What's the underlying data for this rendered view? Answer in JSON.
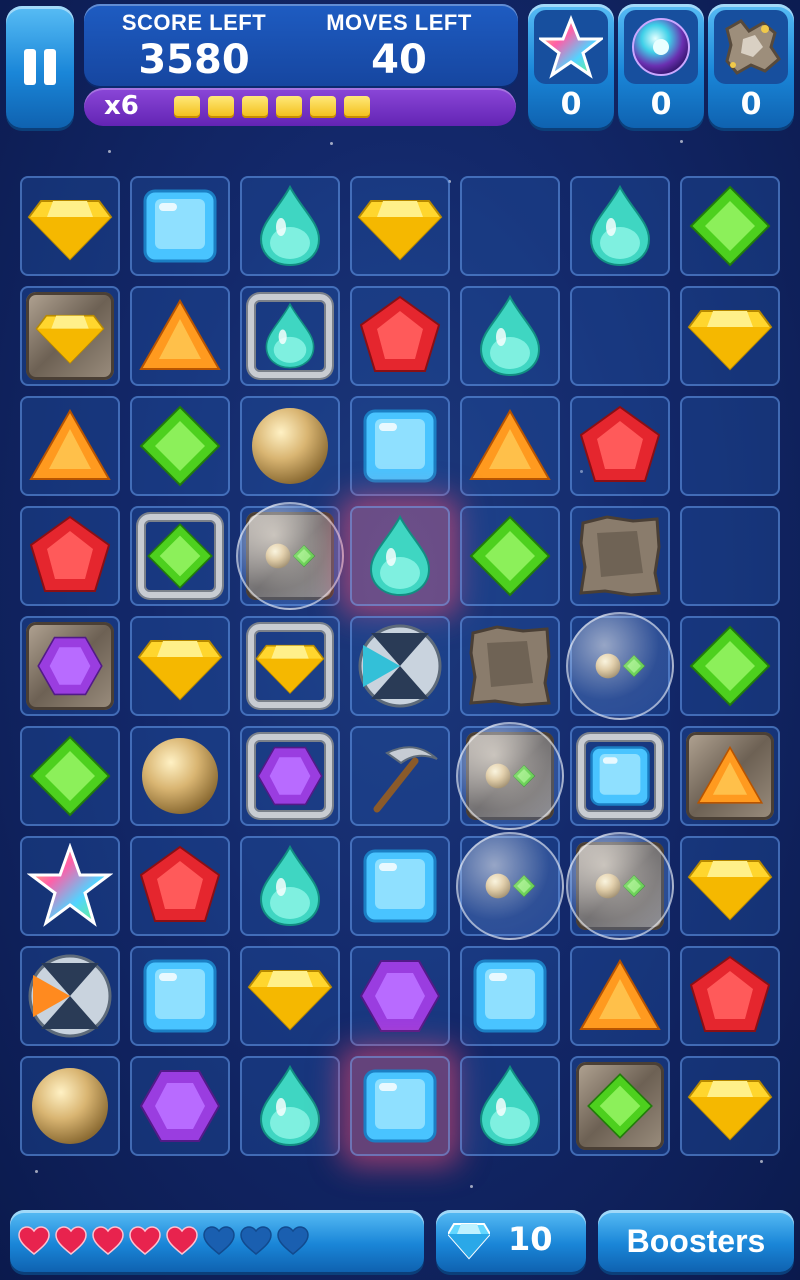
{
  "hud": {
    "score_label": "SCORE LEFT",
    "score_value": "3580",
    "moves_label": "MOVES LEFT",
    "moves_value": "40",
    "multiplier": "x6",
    "multiplier_segments_filled": 6,
    "boosters": [
      {
        "icon": "rainbow-star-icon",
        "count": "0"
      },
      {
        "icon": "color-bomb-orb-icon",
        "count": "0"
      },
      {
        "icon": "rock-blast-icon",
        "count": "0"
      }
    ]
  },
  "board": {
    "columns": 7,
    "rows": 9,
    "cells": [
      [
        "yellow-diamond",
        "blue-square",
        "teal-drop",
        "yellow-diamond",
        "empty",
        "teal-drop",
        "green-rhombus"
      ],
      [
        "rock-yellow-diamond",
        "orange-triangle",
        "chained-teal-drop",
        "red-pentagon",
        "teal-drop",
        "empty",
        "yellow-diamond"
      ],
      [
        "orange-triangle",
        "green-rhombus",
        "tan-ball",
        "blue-square",
        "orange-triangle",
        "red-pentagon",
        "empty"
      ],
      [
        "red-pentagon",
        "chained-green-cross",
        "rock-bubble-mix",
        "glow-teal-drop",
        "green-rhombus",
        "rock-block",
        "empty"
      ],
      [
        "rock-purple-hexagon",
        "yellow-diamond",
        "chained-yellow-arrow",
        "silver-x-bomb",
        "rock-block",
        "bubble-mix",
        "green-rhombus"
      ],
      [
        "green-rhombus",
        "tan-ball",
        "chained-purple-hourglass",
        "pickaxe",
        "rock-bubble-mix",
        "chained-blue-square",
        "rock-orange-triangle"
      ],
      [
        "rainbow-star",
        "red-pentagon",
        "teal-drop",
        "blue-square",
        "bubble-mix",
        "rock-bubble-mix",
        "yellow-diamond"
      ],
      [
        "silver-x-bomb-orange",
        "blue-square",
        "yellow-diamond",
        "purple-hexagon",
        "blue-square",
        "orange-triangle",
        "red-pentagon"
      ],
      [
        "tan-ball",
        "purple-hexagon",
        "teal-drop",
        "glow-blue-square",
        "teal-drop",
        "rock-green-rhombus",
        "yellow-diamond"
      ]
    ]
  },
  "bottom": {
    "hearts_full": 5,
    "hearts_total": 8,
    "gem_count": "10",
    "boosters_label": "Boosters"
  },
  "colors": {
    "background": "#13286a",
    "button_blue": "#1a86d8",
    "multiplier_purple": "#6324b4",
    "heart_red": "#e8234e"
  }
}
